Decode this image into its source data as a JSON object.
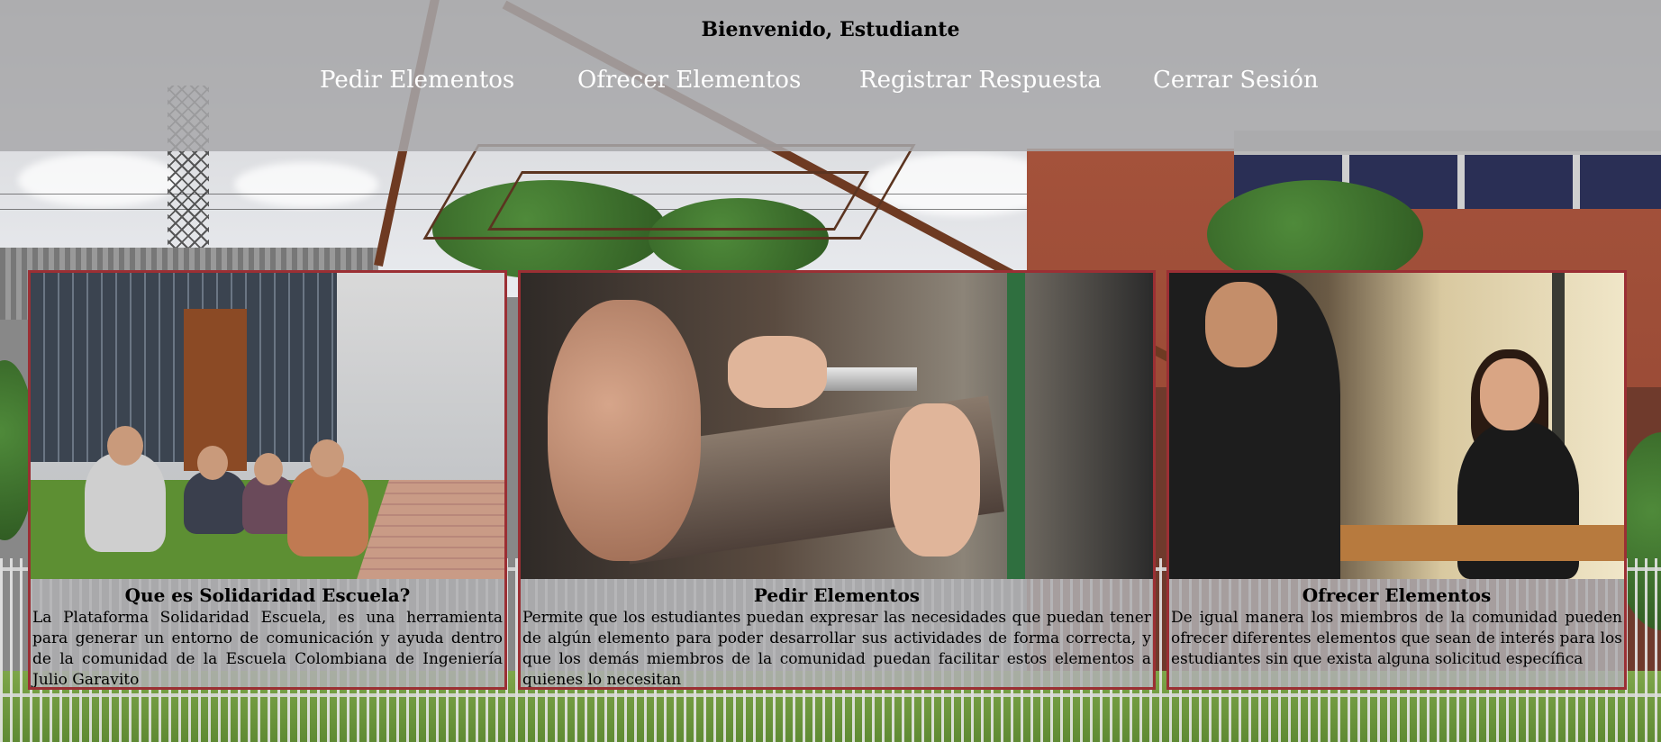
{
  "header": {
    "welcome": "Bienvenido, Estudiante",
    "nav": [
      {
        "label": "Pedir Elementos"
      },
      {
        "label": "Ofrecer Elementos"
      },
      {
        "label": "Registrar Respuesta"
      },
      {
        "label": "Cerrar Sesión"
      }
    ]
  },
  "cards": [
    {
      "title": "Que es Solidaridad Escuela?",
      "text": "La Plataforma Solidaridad Escuela, es una herramienta para generar un entorno de comunicación y ayuda dentro de la comunidad de la Escuela Colombiana de Ingeniería Julio Garavito"
    },
    {
      "title": "Pedir Elementos",
      "text": "Permite que los estudiantes puedan expresar las necesidades que puedan tener de algún elemento para poder desarrollar sus actividades de forma correcta, y que los demás miembros de la comunidad puedan facilitar estos elementos a quienes lo necesitan"
    },
    {
      "title": "Ofrecer Elementos",
      "text": "De igual manera los miembros de la comunidad pueden ofrecer diferentes elementos que sean de interés para los estudiantes sin que exista alguna solicitud específica"
    }
  ],
  "colors": {
    "card_border": "#9b2f34",
    "header_overlay": "#a8a8aa",
    "nav_text": "#ffffff"
  }
}
